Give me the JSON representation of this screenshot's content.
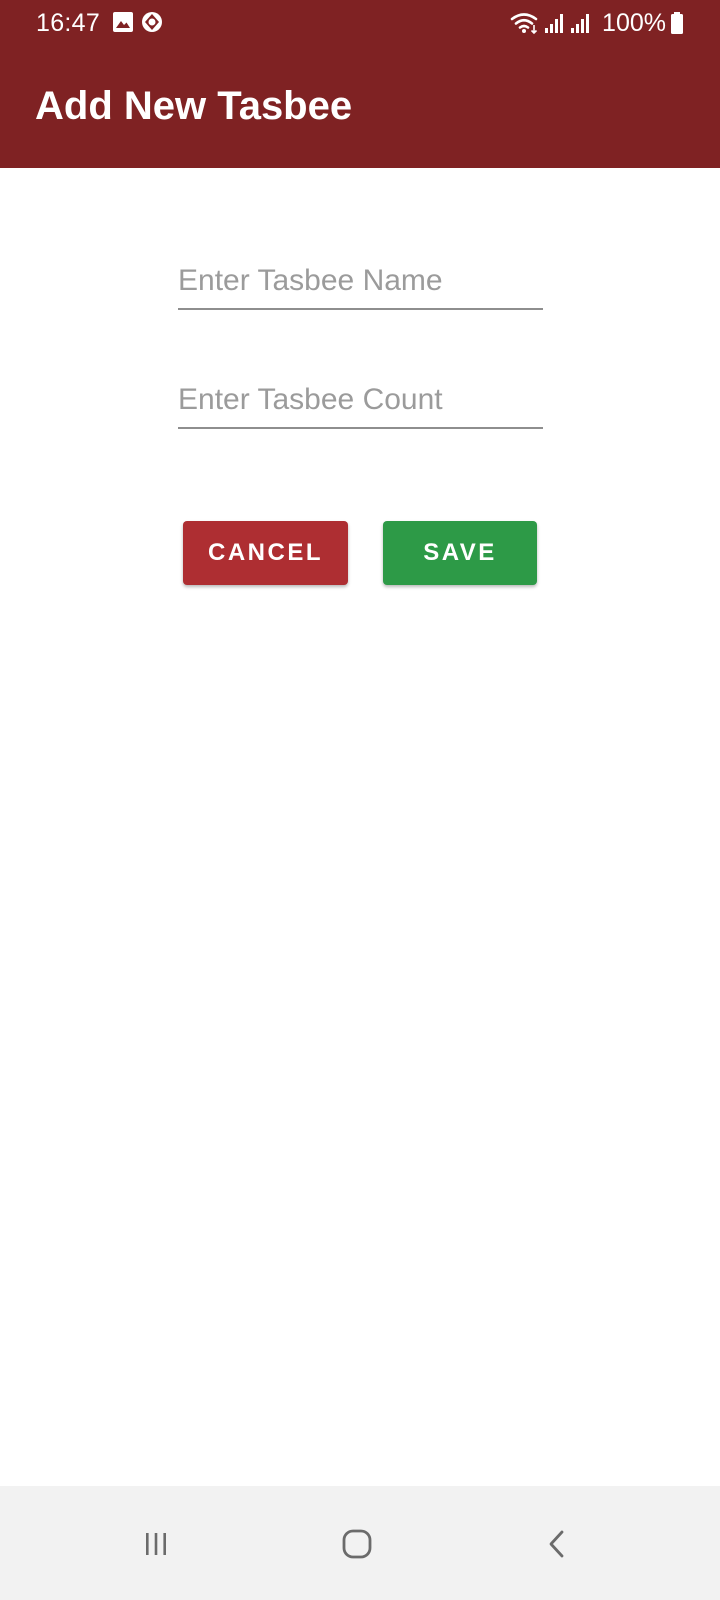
{
  "status_bar": {
    "time": "16:47",
    "notification_icons": [
      "image-icon",
      "app-notification-icon"
    ],
    "battery_percent": "100%",
    "icons": [
      "wifi-icon",
      "signal-icon",
      "signal-icon",
      "battery-icon"
    ]
  },
  "app_bar": {
    "title": "Add New Tasbee",
    "background_color": "#7f2223"
  },
  "form": {
    "name_placeholder": "Enter Tasbee Name",
    "name_value": "",
    "count_placeholder": "Enter Tasbee Count",
    "count_value": ""
  },
  "buttons": {
    "cancel_label": "CANCEL",
    "cancel_color": "#ae2e32",
    "save_label": "SAVE",
    "save_color": "#2d9a47"
  },
  "nav_bar": {
    "icons": [
      "recent-apps-icon",
      "home-icon",
      "back-icon"
    ]
  }
}
